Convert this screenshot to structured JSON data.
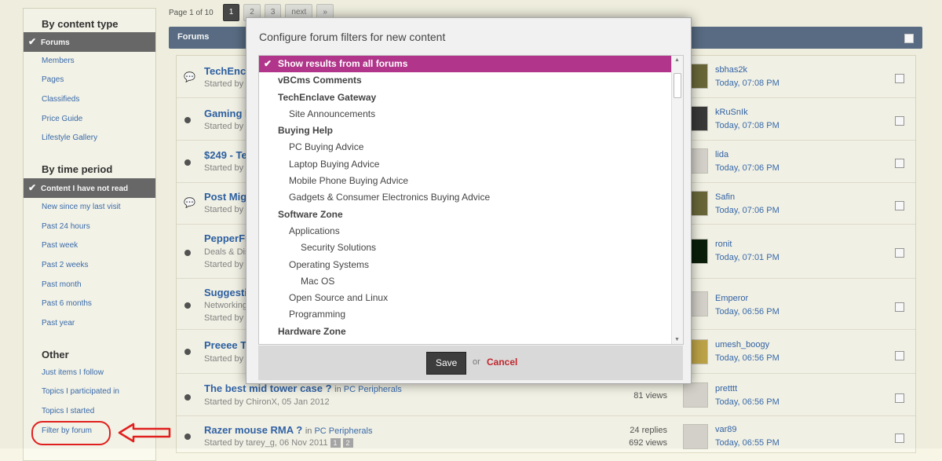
{
  "sidebar": {
    "content_type_heading": "By content type",
    "content_items": [
      "Forums",
      "Members",
      "Pages",
      "Classifieds",
      "Price Guide",
      "Lifestyle Gallery"
    ],
    "time_heading": "By time period",
    "time_items": [
      "Content I have not read",
      "New since my last visit",
      "Past 24 hours",
      "Past week",
      "Past 2 weeks",
      "Past month",
      "Past 6 months",
      "Past year"
    ],
    "other_heading": "Other",
    "other_items": [
      "Just items I follow",
      "Topics I participated in",
      "Topics I started",
      "Filter by forum"
    ]
  },
  "pager": {
    "text": "Page 1 of 10",
    "pages": [
      "1",
      "2",
      "3"
    ],
    "next": "next",
    "last": "»"
  },
  "forum_bar": {
    "title": "Forums"
  },
  "threads": [
    {
      "title": "TechEnc",
      "sub": "Started by S",
      "user": "sbhas2k",
      "time": "Today, 07:08 PM"
    },
    {
      "title": "Gaming H",
      "sub": "Started by k",
      "user": "kRuSnIk",
      "time": "Today, 07:08 PM"
    },
    {
      "title": "$249 - Te",
      "sub": "Started by D",
      "user": "lida",
      "time": "Today, 07:06 PM"
    },
    {
      "title": "Post Mig",
      "sub": "Started by S",
      "user": "Safin",
      "time": "Today, 07:06 PM"
    },
    {
      "title": "PepperFr",
      "sub": "Deals & Dis",
      "sub2": "Started by k",
      "user": "ronit",
      "time": "Today, 07:01 PM"
    },
    {
      "title": "Suggesti",
      "sub": "Networking",
      "sub2": "Started by st",
      "user": "Emperor",
      "time": "Today, 06:56 PM"
    },
    {
      "title": "Preeee T",
      "sub": "Started by c",
      "user": "umesh_boogy",
      "time": "Today, 06:56 PM"
    },
    {
      "title": "The best mid tower case ?",
      "in_label": "in",
      "in_forum": "PC Peripherals",
      "sub": "Started by ChironX, 05 Jan 2012",
      "replies": "",
      "views": "81 views",
      "user": "pretttt",
      "time": "Today, 06:56 PM"
    },
    {
      "title": "Razer mouse RMA ?",
      "in_label": "in",
      "in_forum": "PC Peripherals",
      "sub": "Started by tarey_g, 06 Nov 2011",
      "pages": [
        "1",
        "2"
      ],
      "replies": "24 replies",
      "views": "692 views",
      "user": "var89",
      "time": "Today, 06:55 PM"
    }
  ],
  "dialog": {
    "title": "Configure forum filters for new content",
    "options": [
      {
        "label": "Show results from all forums",
        "level": "sel"
      },
      {
        "label": "vBCms Comments",
        "level": "l0"
      },
      {
        "label": "TechEnclave Gateway",
        "level": "l0"
      },
      {
        "label": "Site Announcements",
        "level": "l1"
      },
      {
        "label": "Buying Help",
        "level": "l0"
      },
      {
        "label": "PC Buying Advice",
        "level": "l1"
      },
      {
        "label": "Laptop Buying Advice",
        "level": "l1"
      },
      {
        "label": "Mobile Phone Buying Advice",
        "level": "l1"
      },
      {
        "label": "Gadgets & Consumer Electronics Buying Advice",
        "level": "l1"
      },
      {
        "label": "Software Zone",
        "level": "l0"
      },
      {
        "label": "Applications",
        "level": "l1"
      },
      {
        "label": "Security Solutions",
        "level": "l2"
      },
      {
        "label": "Operating Systems",
        "level": "l1"
      },
      {
        "label": "Mac OS",
        "level": "l2"
      },
      {
        "label": "Open Source and Linux",
        "level": "l1"
      },
      {
        "label": "Programming",
        "level": "l1"
      },
      {
        "label": "Hardware Zone",
        "level": "l0"
      }
    ],
    "save": "Save",
    "or": "or",
    "cancel": "Cancel"
  },
  "colors": {
    "selected_option": "#b1358a",
    "cancel": "#c0272d",
    "annotation": "#e0201f"
  }
}
